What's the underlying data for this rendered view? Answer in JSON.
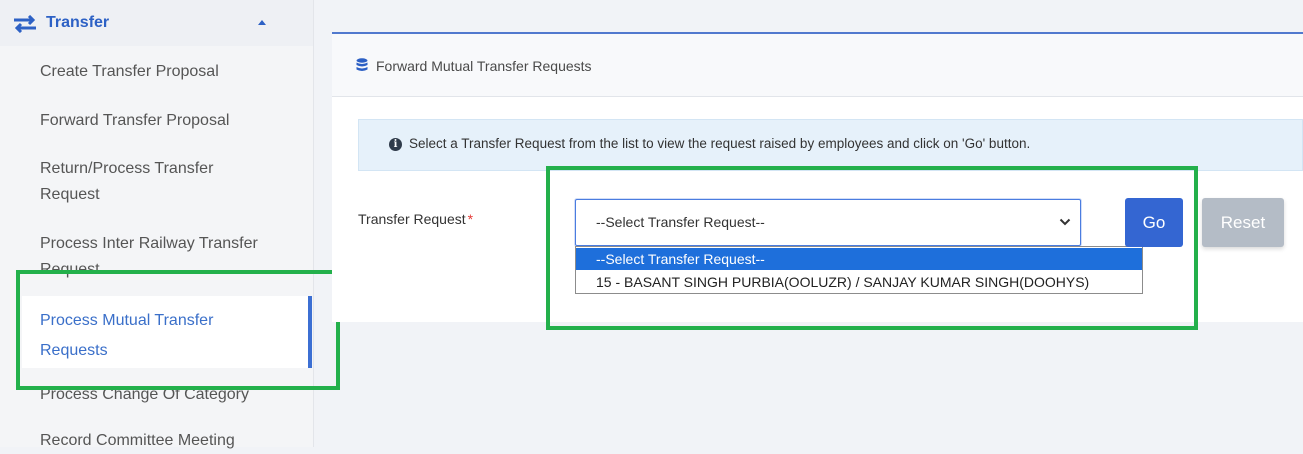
{
  "sidebar": {
    "section_title": "Transfer",
    "items": [
      {
        "label": "Create Transfer Proposal"
      },
      {
        "label": "Forward Transfer Proposal"
      },
      {
        "label": "Return/Process Transfer Request"
      },
      {
        "label": "Process Inter Railway Transfer Request"
      },
      {
        "label": "Process Mutual Transfer Requests"
      },
      {
        "label": "Process Change Of Category"
      },
      {
        "label": "Record Committee Meeting"
      }
    ]
  },
  "card": {
    "title": "Forward Mutual Transfer Requests",
    "alert": "Select a Transfer Request from the list to view the request raised by employees and click on 'Go' button.",
    "field_label": "Transfer Request",
    "required_mark": "*",
    "select": {
      "value": "--Select Transfer Request--",
      "options": [
        "--Select Transfer Request--",
        "15 - BASANT SINGH PURBIA(OOLUZR) / SANJAY KUMAR SINGH(DOOHYS)"
      ]
    },
    "go_label": "Go",
    "reset_label": "Reset"
  },
  "colors": {
    "accent": "#3466d2",
    "highlight_box": "#23b04b",
    "dropdown_selected": "#1e6fdb"
  },
  "icons": [
    "transfer-arrows-icon",
    "caret-up-icon",
    "database-icon",
    "info-icon",
    "chevron-down-icon"
  ]
}
